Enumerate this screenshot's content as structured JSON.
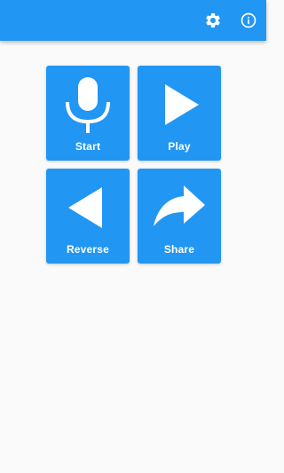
{
  "colors": {
    "primary": "#2196f3",
    "background": "#fafafa",
    "on_primary": "#ffffff"
  },
  "app_bar": {
    "actions": [
      {
        "icon": "gear-icon"
      },
      {
        "icon": "info-icon"
      }
    ]
  },
  "tiles": [
    {
      "label": "Start",
      "icon": "microphone-icon"
    },
    {
      "label": "Play",
      "icon": "play-icon"
    },
    {
      "label": "Reverse",
      "icon": "reverse-icon"
    },
    {
      "label": "Share",
      "icon": "share-icon"
    }
  ]
}
